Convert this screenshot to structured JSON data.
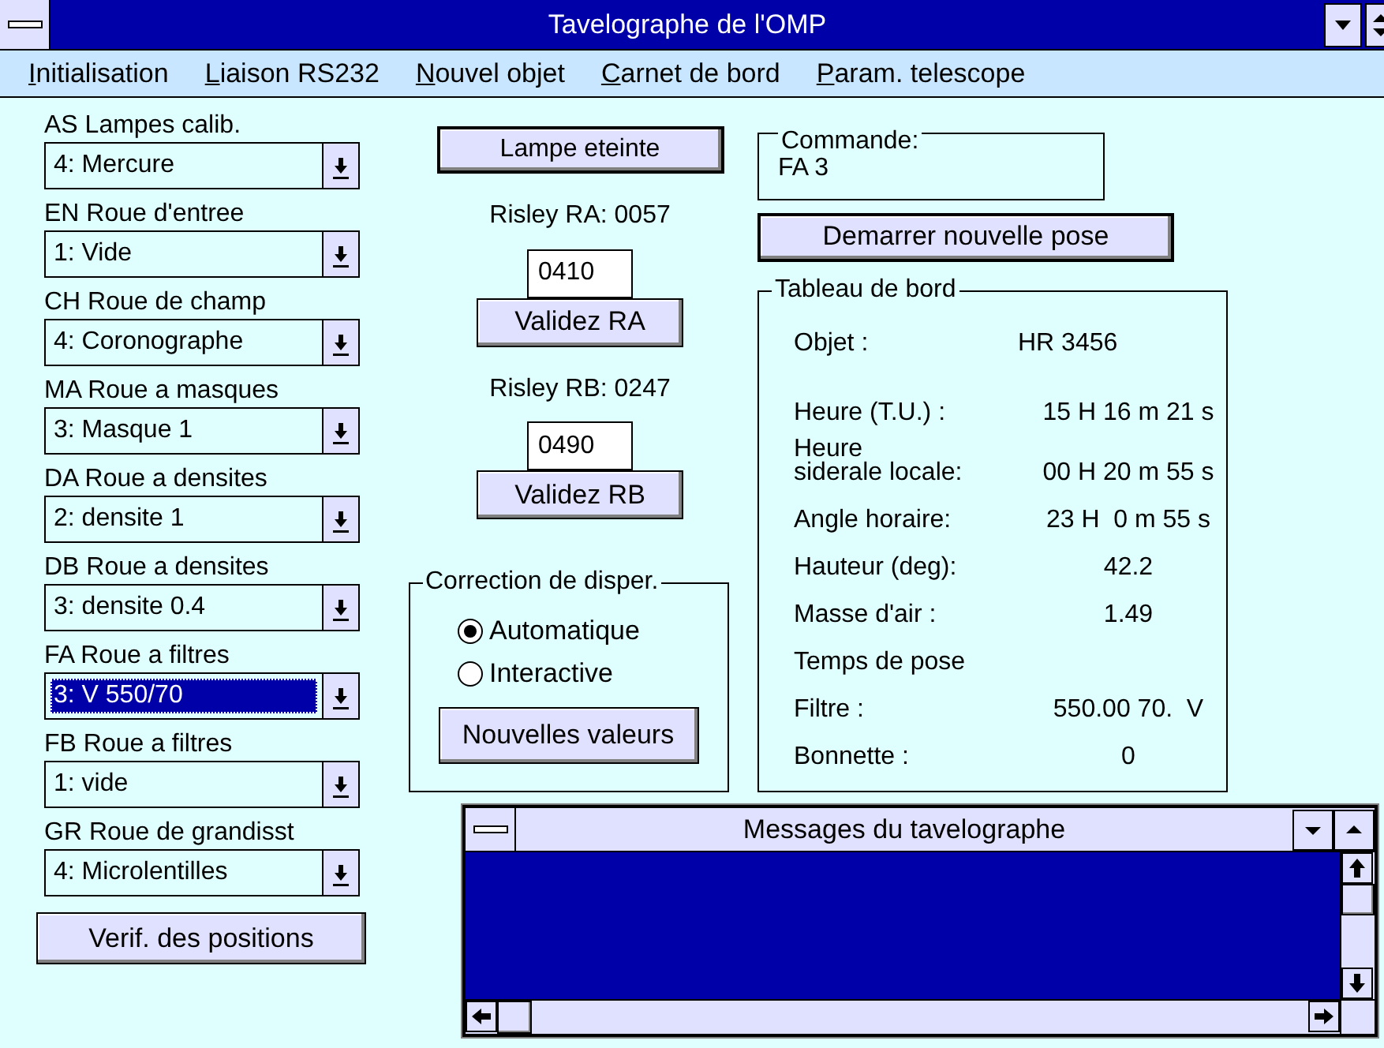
{
  "window": {
    "title": "Tavelographe de l'OMP"
  },
  "menu": [
    "Initialisation",
    "Liaison RS232",
    "Nouvel objet",
    "Carnet de bord",
    "Param. telescope"
  ],
  "selectors": [
    {
      "label": "AS Lampes calib.",
      "value": "4: Mercure",
      "selected": false
    },
    {
      "label": "EN Roue d'entree",
      "value": "1: Vide",
      "selected": false
    },
    {
      "label": "CH Roue de champ",
      "value": "4: Coronographe",
      "selected": false
    },
    {
      "label": "MA Roue a masques",
      "value": "3: Masque 1",
      "selected": false
    },
    {
      "label": "DA Roue a densites",
      "value": "2: densite 1",
      "selected": false
    },
    {
      "label": "DB Roue a densites",
      "value": "3: densite 0.4",
      "selected": false
    },
    {
      "label": "FA Roue a filtres",
      "value": "3: V 550/70",
      "selected": true
    },
    {
      "label": "FB Roue a filtres",
      "value": "1: vide",
      "selected": false
    },
    {
      "label": "GR Roue de grandisst",
      "value": "4: Microlentilles",
      "selected": false
    }
  ],
  "verify_button": "Verif. des positions",
  "lamp_button": "Lampe eteinte",
  "risley": [
    {
      "reading": "Risley RA: 0057",
      "value": "0410",
      "button": "Validez RA"
    },
    {
      "reading": "Risley RB: 0247",
      "value": "0490",
      "button": "Validez RB"
    }
  ],
  "dispersion": {
    "title": "Correction de disper.",
    "options": [
      {
        "label": "Automatique",
        "selected": true
      },
      {
        "label": "Interactive",
        "selected": false
      }
    ],
    "button": "Nouvelles valeurs"
  },
  "command": {
    "title": "Commande:",
    "value": "FA 3"
  },
  "start_button": "Demarrer nouvelle pose",
  "dashboard": {
    "title": "Tableau de bord",
    "rows": [
      {
        "label": "Objet :",
        "value": "HR 3456",
        "kind": "short"
      },
      {
        "label": "Heure (T.U.) :",
        "value": "15 H 16 m 21 s",
        "kind": "wide"
      },
      {
        "label": "Heure\nsiderale locale:",
        "value": "00 H 20 m 55 s",
        "kind": "wide"
      },
      {
        "label": "Angle horaire:",
        "value": "23 H  0 m 55 s",
        "kind": "wide"
      },
      {
        "label": "Hauteur (deg):",
        "value": "42.2",
        "kind": "wide"
      },
      {
        "label": "Masse d'air :",
        "value": "1.49",
        "kind": "wide"
      },
      {
        "label": "Temps de pose",
        "kind": "wide"
      },
      {
        "label": "Filtre :",
        "value": "550.00 70.  V",
        "kind": "wide"
      },
      {
        "label": "Bonnette :",
        "value": "0",
        "kind": "wide"
      }
    ]
  },
  "messages_window": {
    "title": "Messages du tavelographe"
  }
}
